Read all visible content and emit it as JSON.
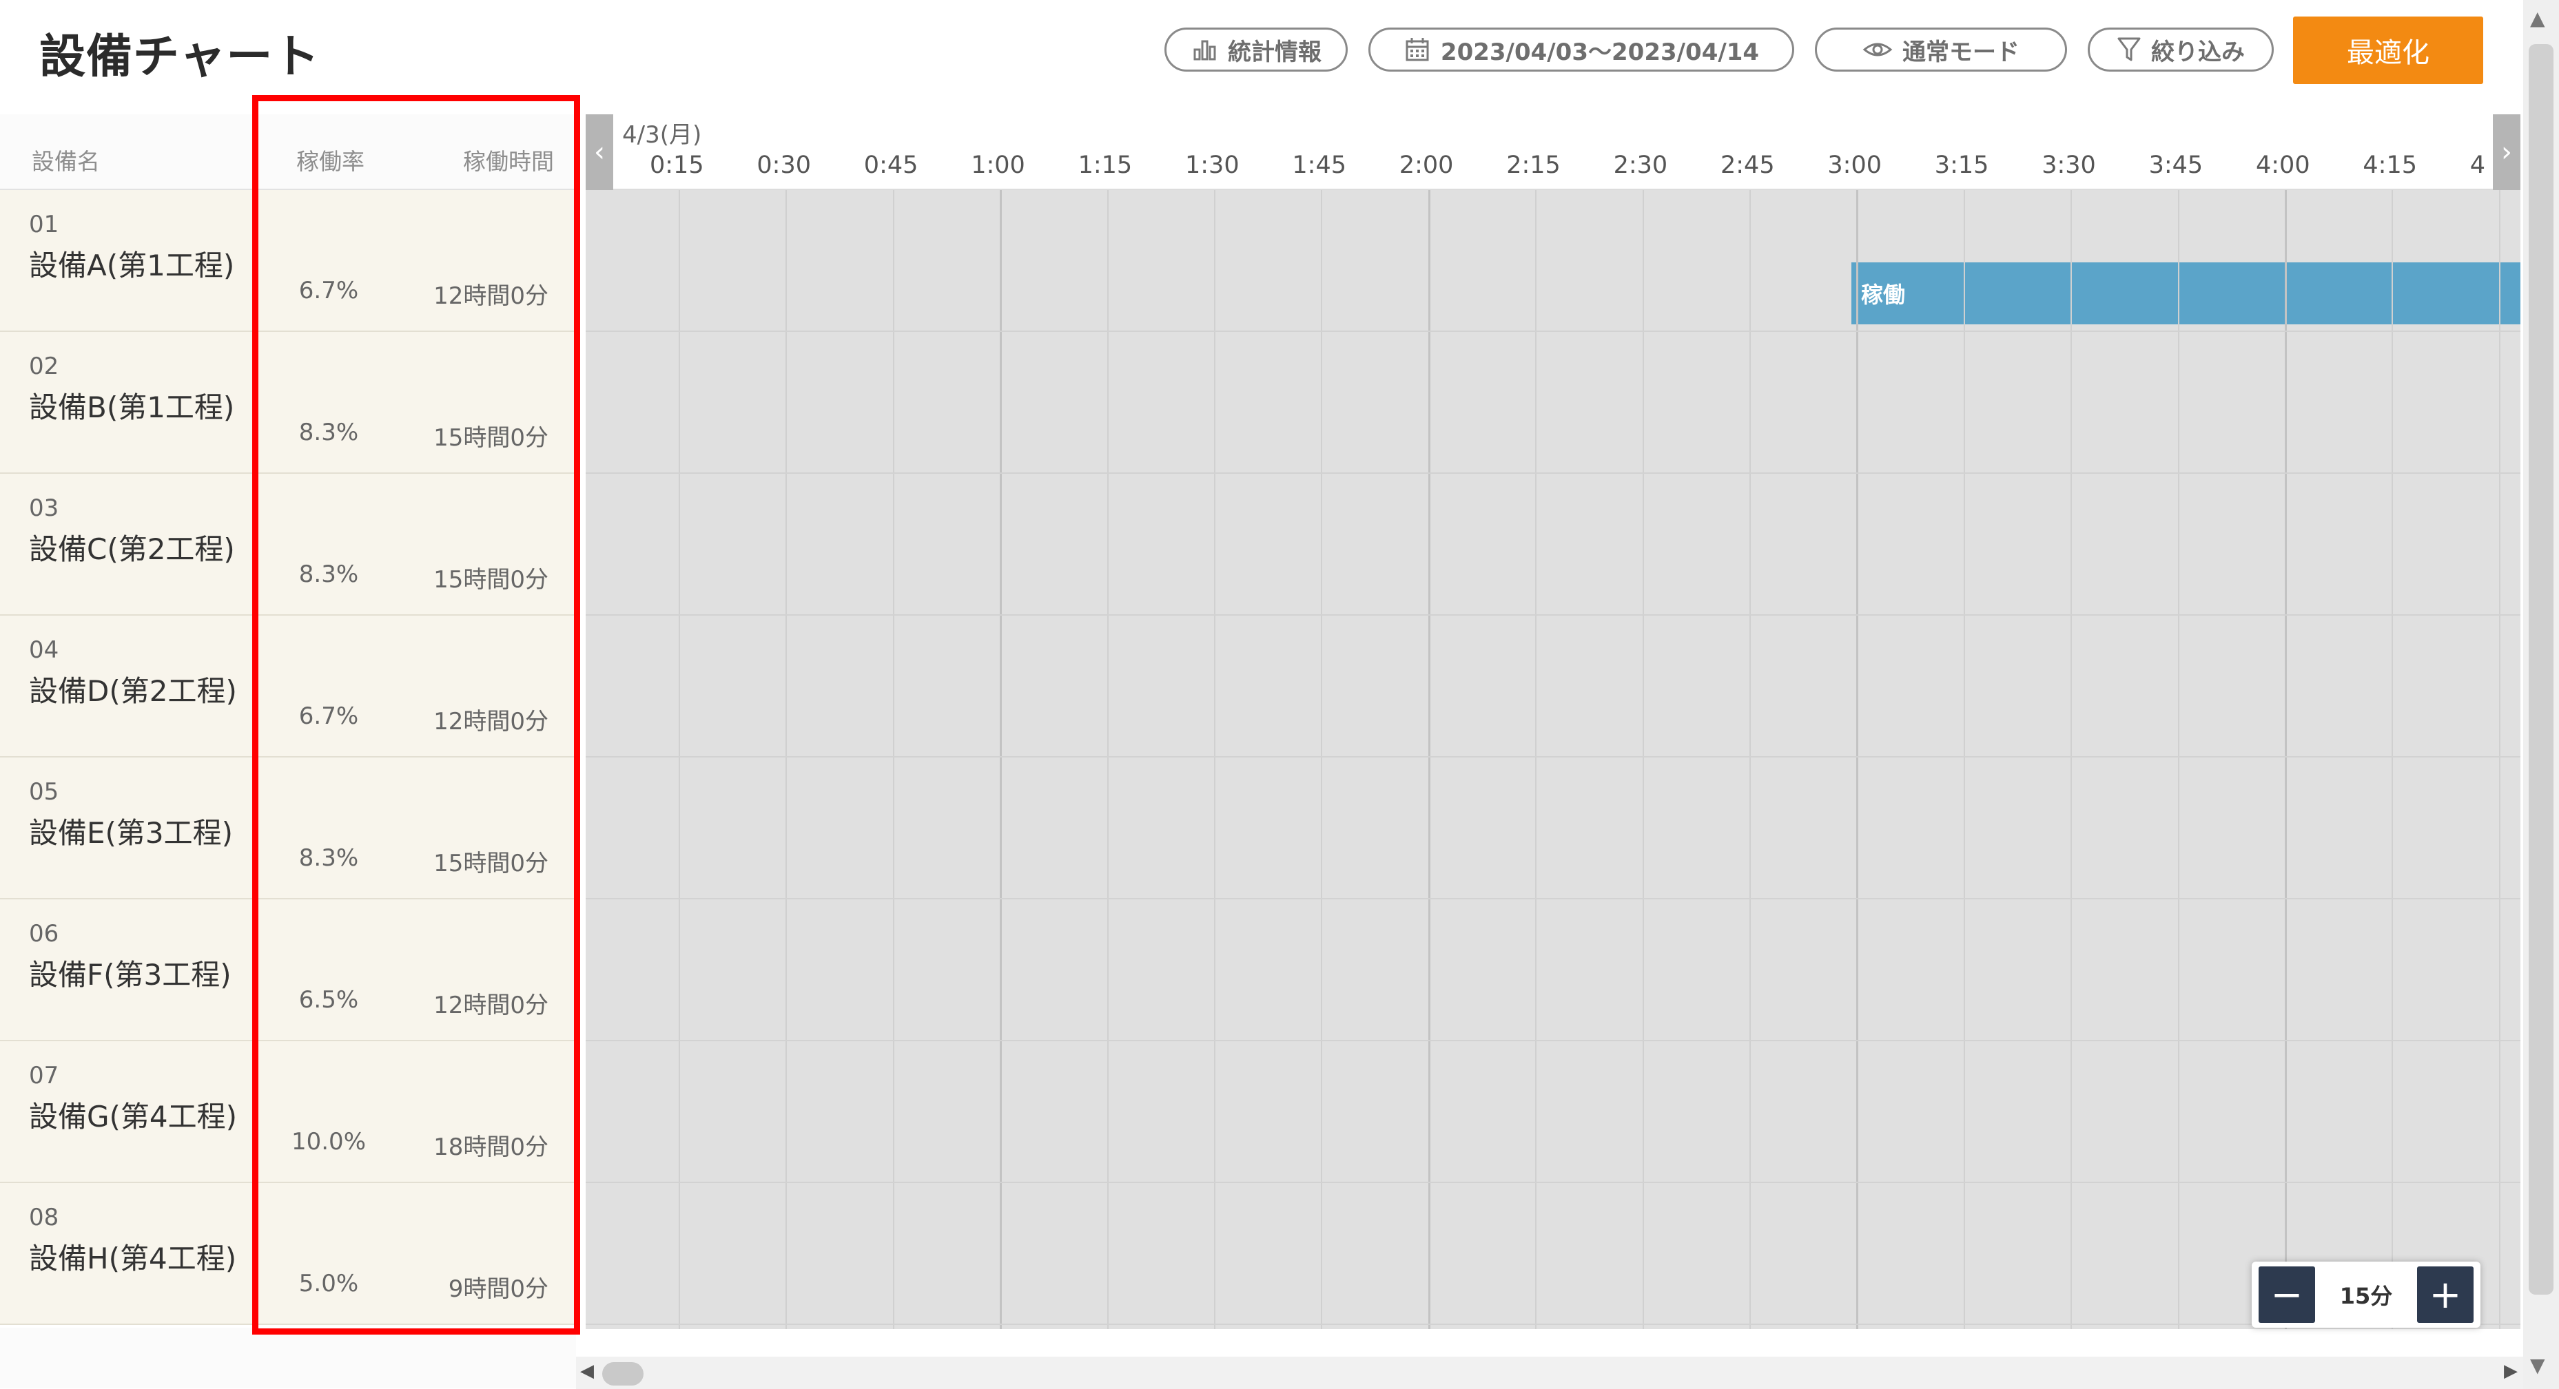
{
  "header": {
    "title": "設備チャート",
    "stats_label": "統計情報",
    "date_range": "2023/04/03〜2023/04/14",
    "mode_label": "通常モード",
    "filter_label": "絞り込み",
    "optimize_label": "最適化"
  },
  "table": {
    "col_name": "設備名",
    "col_rate": "稼働率",
    "col_time": "稼働時間",
    "rows": [
      {
        "code": "01",
        "name": "設備A(第1工程)",
        "rate": "6.7%",
        "time": "12時間0分"
      },
      {
        "code": "02",
        "name": "設備B(第1工程)",
        "rate": "8.3%",
        "time": "15時間0分"
      },
      {
        "code": "03",
        "name": "設備C(第2工程)",
        "rate": "8.3%",
        "time": "15時間0分"
      },
      {
        "code": "04",
        "name": "設備D(第2工程)",
        "rate": "6.7%",
        "time": "12時間0分"
      },
      {
        "code": "05",
        "name": "設備E(第3工程)",
        "rate": "8.3%",
        "time": "15時間0分"
      },
      {
        "code": "06",
        "name": "設備F(第3工程)",
        "rate": "6.5%",
        "time": "12時間0分"
      },
      {
        "code": "07",
        "name": "設備G(第4工程)",
        "rate": "10.0%",
        "time": "18時間0分"
      },
      {
        "code": "08",
        "name": "設備H(第4工程)",
        "rate": "5.0%",
        "time": "9時間0分"
      }
    ]
  },
  "chart": {
    "date_label": "4/3(月)",
    "ticks": [
      "0:15",
      "0:30",
      "0:45",
      "1:00",
      "1:15",
      "1:30",
      "1:45",
      "2:00",
      "2:15",
      "2:30",
      "2:45",
      "3:00",
      "3:15",
      "3:30",
      "3:45",
      "4:00",
      "4:15",
      "4"
    ],
    "bar_label": "稼働",
    "bar_color": "#5ba4c9"
  },
  "zoom": {
    "minus": "−",
    "label": "15分",
    "plus": "+"
  },
  "colors": {
    "accent": "#f38a12",
    "highlight_border": "#ff0000",
    "zoom_button": "#2d3a4f"
  }
}
